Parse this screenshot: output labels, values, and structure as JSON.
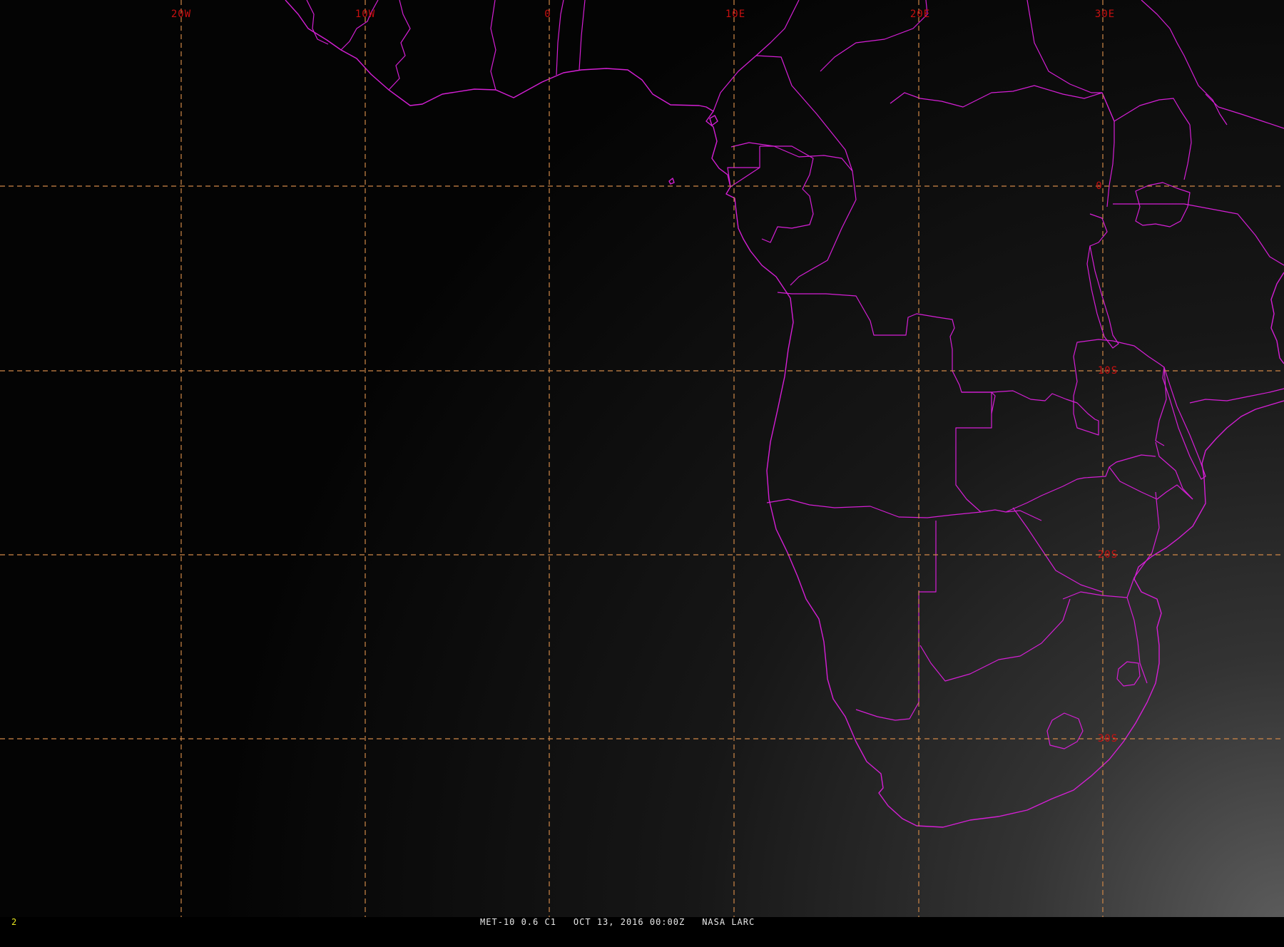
{
  "map": {
    "longitude_labels": [
      "20W",
      "10W",
      "0",
      "10E",
      "20E",
      "30E"
    ],
    "latitude_labels": [
      "0",
      "10S",
      "20S",
      "30S"
    ],
    "colors": {
      "background_dark": "#040404",
      "background_light": "#5c5c5c",
      "boundaries": "#d51fd5",
      "grid": "#d08848",
      "grid_labels": "#c81010"
    }
  },
  "status_bar": {
    "frame_number": "2",
    "satellite_band": "MET-10 0.6 C1",
    "datetime": "OCT 13, 2016 00:00Z",
    "source": "NASA LARC",
    "frame_color": "#e8e820"
  }
}
